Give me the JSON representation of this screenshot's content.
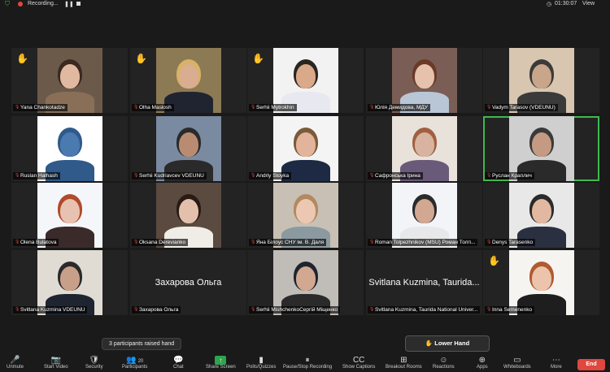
{
  "topbar": {
    "recording": "Recording...",
    "timer": "01:30:07",
    "view": "View"
  },
  "tiles": [
    {
      "name": "Yana Chankotadze",
      "hand": true,
      "bg": "#6b5a4a",
      "skin": "#e0b9a0",
      "hair": "#3a2a20",
      "cloth": "#8a6f58"
    },
    {
      "name": "Olha Maslosh",
      "hand": true,
      "bg": "#8c7a55",
      "skin": "#d8ad90",
      "hair": "#d8b266",
      "cloth": "#1f2430"
    },
    {
      "name": "Serhii Mytrokhin",
      "hand": true,
      "bg": "#f2f2f2",
      "skin": "#d9a98a",
      "hair": "#2b2520",
      "cloth": "#e8e8f0"
    },
    {
      "name": "Юлія Демидова, МДУ",
      "hand": false,
      "bg": "#7a5e55",
      "skin": "#e6c2ad",
      "hair": "#6a3a28",
      "cloth": "#b9c6d6"
    },
    {
      "name": "Vadym Tarasov (VDEUNU)",
      "hand": false,
      "bg": "#d8c6b0",
      "skin": "#c9a58a",
      "hair": "#3a3a3a",
      "cloth": "#3a3a3a"
    },
    {
      "name": "Ruslan Halhash",
      "hand": false,
      "bg": "#ffffff",
      "skin": "#4a7ab0",
      "hair": "#2f5a8a",
      "cloth": "#2f5a8a"
    },
    {
      "name": "Serhii Kudriavcev VDEUNU",
      "hand": false,
      "bg": "#7a8aa0",
      "skin": "#b98c72",
      "hair": "#2a2a2a",
      "cloth": "#2a2a2a"
    },
    {
      "name": "Andriy Stoyka",
      "hand": false,
      "bg": "#f4f4f4",
      "skin": "#e3b49c",
      "hair": "#7a5a3a",
      "cloth": "#1e2a44"
    },
    {
      "name": "Сафронська Ірина",
      "hand": false,
      "bg": "#e8e2da",
      "skin": "#d8b4a0",
      "hair": "#a06040",
      "cloth": "#6a5a7a"
    },
    {
      "name": "Руслан Краплич",
      "hand": false,
      "bg": "#cfcfcf",
      "skin": "#c49a82",
      "hair": "#3a3a3a",
      "cloth": "#2a2a2a",
      "active": true
    },
    {
      "name": "Olena Bulatova",
      "hand": false,
      "bg": "#f4f6fa",
      "skin": "#e8c2b0",
      "hair": "#b04a2a",
      "cloth": "#3a2a2a"
    },
    {
      "name": "Oksana Derevianko",
      "hand": false,
      "bg": "#5a4a40",
      "skin": "#e2c0ac",
      "hair": "#2a1a14",
      "cloth": "#f0ece6"
    },
    {
      "name": "Яна Білоус СНУ ім. В. Даля",
      "hand": false,
      "bg": "#c8c0b4",
      "skin": "#ecc8b2",
      "hair": "#b08a60",
      "cloth": "#8a9aa0"
    },
    {
      "name": "Roman Tolpezhnikov (MSU) Роман Толп...",
      "hand": false,
      "bg": "#f2f4f8",
      "skin": "#d2a892",
      "hair": "#2a2a2a",
      "cloth": "#e8e8ea"
    },
    {
      "name": "Denys Tarasenko",
      "hand": false,
      "bg": "#e8e8e8",
      "skin": "#e2b8a0",
      "hair": "#2a2a2a",
      "cloth": "#2a3040"
    },
    {
      "name": "Svitlana Kuzmina VDEUNU",
      "hand": false,
      "bg": "#e0dcd4",
      "skin": "#c8a08a",
      "hair": "#2a2a2a",
      "cloth": "#1e2430"
    },
    {
      "name": "Захарова Ольга",
      "hand": false,
      "big": "Захарова Ольга"
    },
    {
      "name": "Serhii MishchenkoСергій Міщенко",
      "hand": false,
      "bg": "#c0bcb8",
      "skin": "#d2a890",
      "hair": "#1e2430",
      "cloth": "#2a2a2a"
    },
    {
      "name": "Svitlana Kuzmina, Taurida National Univer...",
      "hand": false,
      "big": "Svitlana Kuzmina, Taurida..."
    },
    {
      "name": "Inna Semenenko",
      "hand": true,
      "bg": "#f6f4f0",
      "skin": "#ecc4ac",
      "hair": "#b05a30",
      "cloth": "#1e1e1e"
    }
  ],
  "tooltip": "3 participants raised hand",
  "lower_hand": "Lower Hand",
  "toolbar": [
    {
      "label": "Unmute",
      "icon": "🎤",
      "icon_name": "mic-off-icon"
    },
    {
      "label": "Start Video",
      "icon": "📷",
      "icon_name": "video-off-icon"
    },
    {
      "label": "Security",
      "icon": "🛡",
      "icon_name": "shield-icon"
    },
    {
      "label": "Participants",
      "icon": "👥",
      "icon_name": "participants-icon",
      "count": "20"
    },
    {
      "label": "Chat",
      "icon": "💬",
      "icon_name": "chat-icon"
    },
    {
      "label": "Share Screen",
      "icon": "↑",
      "icon_name": "share-screen-icon",
      "green": true
    },
    {
      "label": "Polls/Quizzes",
      "icon": "▮",
      "icon_name": "polls-icon"
    },
    {
      "label": "Pause/Stop Recording",
      "icon": "⏸",
      "icon_name": "pause-recording-icon"
    },
    {
      "label": "Show Captions",
      "icon": "CC",
      "icon_name": "captions-icon"
    },
    {
      "label": "Breakout Rooms",
      "icon": "⊞",
      "icon_name": "breakout-rooms-icon"
    },
    {
      "label": "Reactions",
      "icon": "☺",
      "icon_name": "reactions-icon"
    },
    {
      "label": "Apps",
      "icon": "⊕",
      "icon_name": "apps-icon"
    },
    {
      "label": "Whiteboards",
      "icon": "▭",
      "icon_name": "whiteboards-icon"
    },
    {
      "label": "More",
      "icon": "⋯",
      "icon_name": "more-icon"
    }
  ],
  "end_label": "End"
}
